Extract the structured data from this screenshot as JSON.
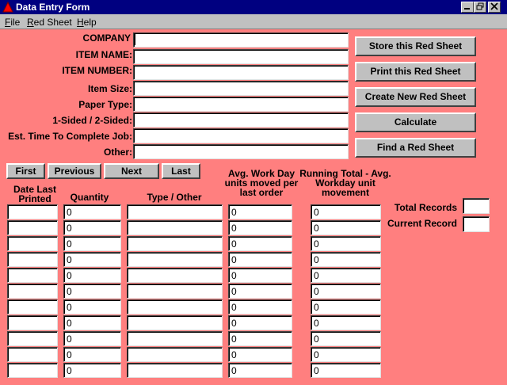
{
  "window": {
    "title": "Data Entry Form"
  },
  "menu": [
    {
      "label": "File",
      "accel": "F",
      "rest": "ile"
    },
    {
      "label": "Red Sheet",
      "accel": "R",
      "rest": "ed Sheet"
    },
    {
      "label": "Help",
      "accel": "H",
      "rest": "elp"
    }
  ],
  "form": {
    "fields": [
      {
        "label": "COMPANY",
        "value": ""
      },
      {
        "label": "ITEM NAME:",
        "value": ""
      },
      {
        "label": "ITEM NUMBER:",
        "value": ""
      },
      {
        "label": "Item Size:",
        "value": ""
      },
      {
        "label": "Paper Type:",
        "value": ""
      },
      {
        "label": "1-Sided / 2-Sided:",
        "value": ""
      },
      {
        "label": "Est. Time To Complete Job:",
        "value": ""
      },
      {
        "label": "Other:",
        "value": ""
      }
    ]
  },
  "actions": {
    "store": "Store this Red Sheet",
    "print": "Print this Red Sheet",
    "create": "Create New Red Sheet",
    "calculate": "Calculate",
    "find": "Find a Red Sheet"
  },
  "nav": {
    "first": "First",
    "previous": "Previous",
    "next": "Next",
    "last": "Last"
  },
  "grid": {
    "headers": {
      "date": "Date Last Printed",
      "quantity": "Quantity",
      "type": "Type / Other",
      "avg": "Avg. Work Day units moved per last order",
      "running": "Running Total - Avg. Workday unit movement"
    },
    "rows": [
      {
        "date": "",
        "quantity": "0",
        "type": "",
        "avg": "0",
        "running": "0"
      },
      {
        "date": "",
        "quantity": "0",
        "type": "",
        "avg": "0",
        "running": "0"
      },
      {
        "date": "",
        "quantity": "0",
        "type": "",
        "avg": "0",
        "running": "0"
      },
      {
        "date": "",
        "quantity": "0",
        "type": "",
        "avg": "0",
        "running": "0"
      },
      {
        "date": "",
        "quantity": "0",
        "type": "",
        "avg": "0",
        "running": "0"
      },
      {
        "date": "",
        "quantity": "0",
        "type": "",
        "avg": "0",
        "running": "0"
      },
      {
        "date": "",
        "quantity": "0",
        "type": "",
        "avg": "0",
        "running": "0"
      },
      {
        "date": "",
        "quantity": "0",
        "type": "",
        "avg": "0",
        "running": "0"
      },
      {
        "date": "",
        "quantity": "0",
        "type": "",
        "avg": "0",
        "running": "0"
      },
      {
        "date": "",
        "quantity": "0",
        "type": "",
        "avg": "0",
        "running": "0"
      },
      {
        "date": "",
        "quantity": "0",
        "type": "",
        "avg": "0",
        "running": "0"
      }
    ]
  },
  "records": {
    "total_label": "Total Records",
    "total_value": "",
    "current_label": "Current Record",
    "current_value": ""
  },
  "colors": {
    "background": "#ff7f7f",
    "titlebar": "#000080",
    "chrome": "#c0c0c0"
  }
}
